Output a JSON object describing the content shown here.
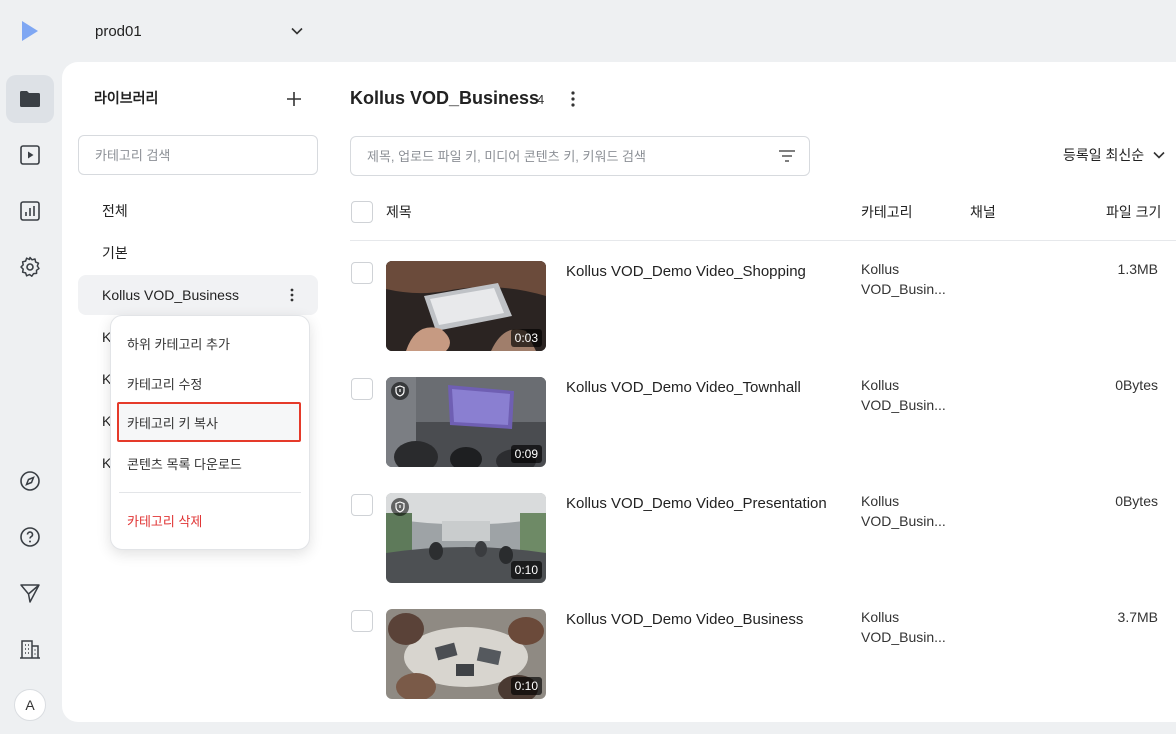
{
  "workspace": {
    "name": "prod01"
  },
  "library": {
    "title": "라이브러리",
    "search_placeholder": "카테고리 검색",
    "categories": [
      {
        "label": "전체"
      },
      {
        "label": "기본"
      },
      {
        "label": "Kollus VOD_Business"
      },
      {
        "label": "K"
      },
      {
        "label": "K"
      },
      {
        "label": "K"
      },
      {
        "label": "K"
      }
    ]
  },
  "context_menu": {
    "items": [
      {
        "label": "하위 카테고리 추가"
      },
      {
        "label": "카테고리 수정"
      },
      {
        "label": "카테고리 키 복사"
      },
      {
        "label": "콘텐츠 목록 다운로드"
      }
    ],
    "delete_label": "카테고리 삭제",
    "highlight_color": "#e53a2a"
  },
  "content": {
    "title": "Kollus VOD_Business",
    "count": "4",
    "search_placeholder": "제목, 업로드 파일 키, 미디어 콘텐츠 키, 키워드 검색",
    "sort_label": "등록일 최신순",
    "columns": {
      "title": "제목",
      "category": "카테고리",
      "channel": "채널",
      "size": "파일 크기"
    },
    "rows": [
      {
        "title": "Kollus VOD_Demo Video_Shopping",
        "category_line1": "Kollus",
        "category_line2": "VOD_Busin...",
        "size": "1.3MB",
        "duration": "0:03",
        "drm": false
      },
      {
        "title": "Kollus VOD_Demo Video_Townhall",
        "category_line1": "Kollus",
        "category_line2": "VOD_Busin...",
        "size": "0Bytes",
        "duration": "0:09",
        "drm": true
      },
      {
        "title": "Kollus VOD_Demo Video_Presentation",
        "category_line1": "Kollus",
        "category_line2": "VOD_Busin...",
        "size": "0Bytes",
        "duration": "0:10",
        "drm": true
      },
      {
        "title": "Kollus VOD_Demo Video_Business",
        "category_line1": "Kollus",
        "category_line2": "VOD_Busin...",
        "size": "3.7MB",
        "duration": "0:10",
        "drm": false
      }
    ]
  },
  "user": {
    "avatar_initial": "A"
  },
  "colors": {
    "brand": "#5b8def",
    "danger": "#e03535"
  }
}
